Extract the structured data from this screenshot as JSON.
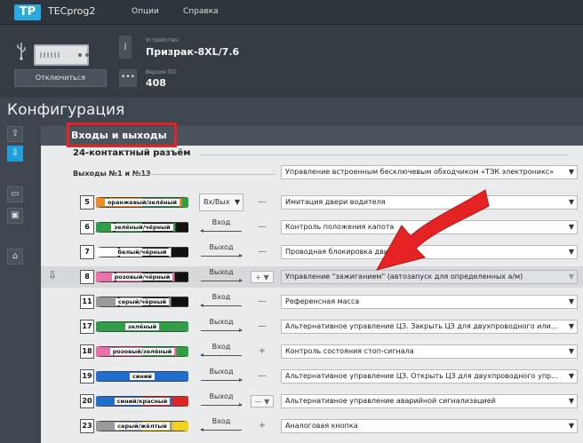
{
  "app": {
    "title": "TECprog2",
    "logo": "TP",
    "menu": [
      "Опции",
      "Справка"
    ]
  },
  "device": {
    "disconnect_label": "Отключиться",
    "model_label": "Устройство:",
    "model_value": "Призрак-8XL/7.6",
    "fw_label": "Версия ПО:",
    "fw_value": "408"
  },
  "page": {
    "title": "Конфигурация",
    "section_title": "Входы и выходы",
    "connector_title": "24-контактный разъём",
    "outputs_title": "Выходы №1 и №13",
    "outputs_function": "Управление встроенным бесключевым обходчиком «ТЭК электроникс»"
  },
  "rows": [
    {
      "num": "5",
      "wire": "оранжевый/зелёный",
      "c1": "#f08a24",
      "c2": "#2ea043",
      "dir": "Вх/Вых",
      "dirtype": "bi",
      "pol": "—",
      "polsel": false,
      "func": "Имитация двери водителя"
    },
    {
      "num": "6",
      "wire": "зелёный/чёрный",
      "c1": "#2ea043",
      "c2": "#111111",
      "dir": "Вход",
      "dirtype": "in",
      "pol": "—",
      "polsel": false,
      "func": "Контроль положения капота"
    },
    {
      "num": "7",
      "wire": "белый/чёрный",
      "c1": "#ffffff",
      "c2": "#111111",
      "dir": "Выход",
      "dirtype": "out",
      "pol": "—",
      "polsel": false,
      "func": "Проводная блокировка двигателя"
    },
    {
      "num": "8",
      "wire": "розовый/чёрный",
      "c1": "#ec6fa8",
      "c2": "#111111",
      "dir": "Выход",
      "dirtype": "out",
      "pol": "+ ▼",
      "polsel": true,
      "func": "Управление \"зажиганием\" (автозапуск для определенных а/м)",
      "highlight": true
    },
    {
      "num": "11",
      "wire": "серый/чёрный",
      "c1": "#9a9a9a",
      "c2": "#111111",
      "dir": "Вход",
      "dirtype": "in",
      "pol": "—",
      "polsel": false,
      "func": "Референсная масса"
    },
    {
      "num": "17",
      "wire": "зелёный",
      "c1": "#2ea043",
      "c2": "#2ea043",
      "dir": "Выход",
      "dirtype": "out",
      "pol": "—",
      "polsel": false,
      "func": "Альтернативное управление ЦЗ. Закрыть ЦЗ для двухпроводного или..."
    },
    {
      "num": "18",
      "wire": "розовый/зелёный",
      "c1": "#ec6fa8",
      "c2": "#2ea043",
      "dir": "Вход",
      "dirtype": "in",
      "pol": "+",
      "polsel": false,
      "func": "Контроль состояния стоп-сигнала"
    },
    {
      "num": "19",
      "wire": "синий",
      "c1": "#1f6fd1",
      "c2": "#1f6fd1",
      "dir": "Выход",
      "dirtype": "out",
      "pol": "—",
      "polsel": false,
      "func": "Альтернативное управление ЦЗ. Открыть ЦЗ для двухпроводного упр..."
    },
    {
      "num": "20",
      "wire": "синий/красный",
      "c1": "#1f6fd1",
      "c2": "#e02424",
      "dir": "Выход",
      "dirtype": "out",
      "pol": "— ▼",
      "polsel": true,
      "func": "Альтернативное управление аварийной сигнализацией"
    },
    {
      "num": "23",
      "wire": "серый/жёлтый",
      "c1": "#9a9a9a",
      "c2": "#f2d21b",
      "dir": "Вход",
      "dirtype": "in",
      "pol": "+",
      "polsel": false,
      "func": "Аналоговая кнопка"
    }
  ],
  "icons": {
    "usb": "usb-icon",
    "info": "info-icon",
    "more": "more-icon",
    "side": [
      "upload-icon",
      "device-config-icon",
      "folder-icon",
      "save-icon",
      "home-icon"
    ],
    "row_action": "download-icon"
  },
  "colors": {
    "accent": "#1f9ed9",
    "highlight_box": "#e52323",
    "annotation_arrow": "#e52323"
  }
}
